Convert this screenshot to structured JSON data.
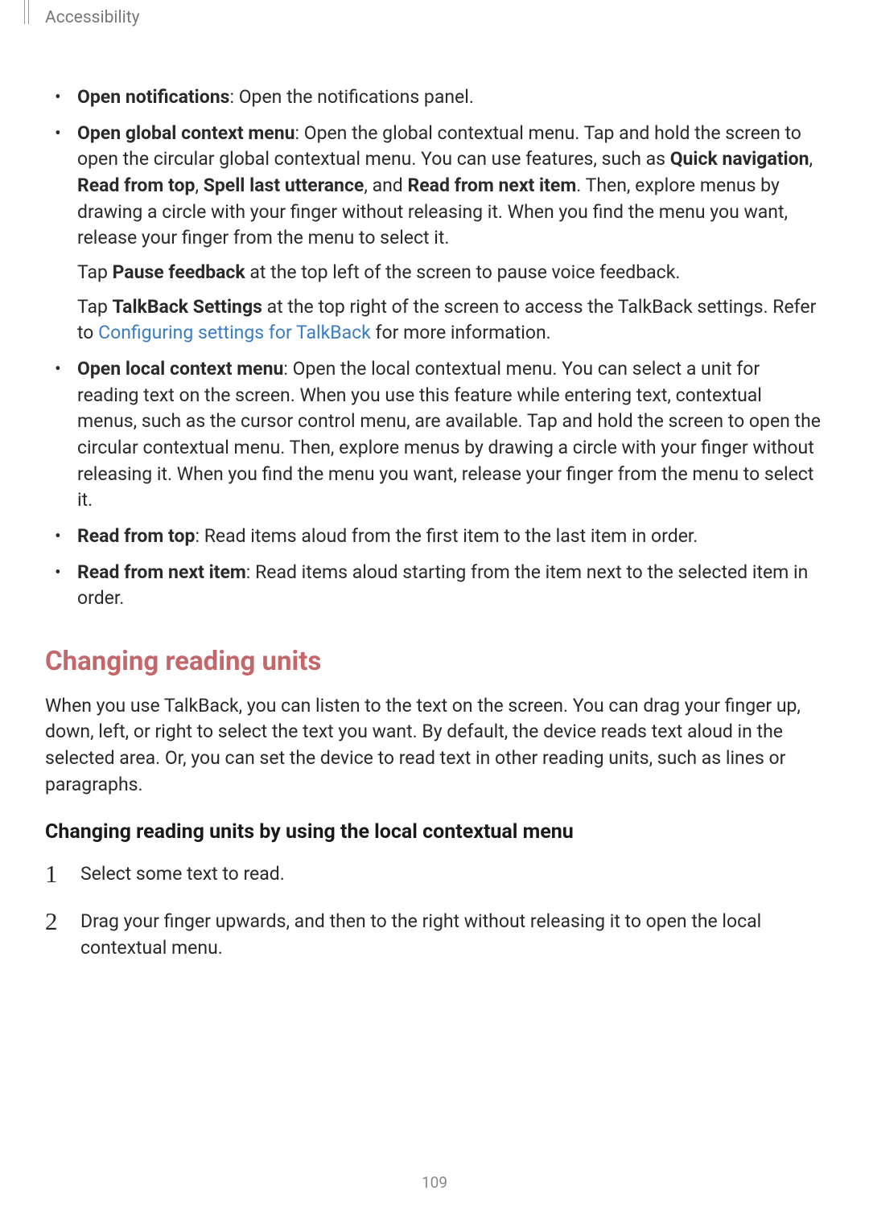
{
  "header": {
    "section": "Accessibility"
  },
  "bullets": {
    "item1": {
      "bold": "Open notifications",
      "rest": ": Open the notifications panel."
    },
    "item2": {
      "bold": "Open global context menu",
      "rest_part1": ": Open the global contextual menu. Tap and hold the screen to open the circular global contextual menu. You can use features, such as ",
      "b1": "Quick navigation",
      "c1": ", ",
      "b2": "Read from top",
      "c2": ", ",
      "b3": "Spell last utterance",
      "c3": ", and ",
      "b4": "Read from next item",
      "rest_part2": ". Then, explore menus by drawing a circle with your finger without releasing it. When you find the menu you want, release your finger from the menu to select it.",
      "sub1_a": "Tap ",
      "sub1_b": "Pause feedback",
      "sub1_c": " at the top left of the screen to pause voice feedback.",
      "sub2_a": "Tap ",
      "sub2_b": "TalkBack Settings",
      "sub2_c": " at the top right of the screen to access the TalkBack settings. Refer to ",
      "sub2_link": "Configuring settings for TalkBack",
      "sub2_d": " for more information."
    },
    "item3": {
      "bold": "Open local context menu",
      "rest": ": Open the local contextual menu. You can select a unit for reading text on the screen. When you use this feature while entering text, contextual menus, such as the cursor control menu, are available. Tap and hold the screen to open the circular contextual menu. Then, explore menus by drawing a circle with your finger without releasing it. When you find the menu you want, release your finger from the menu to select it."
    },
    "item4": {
      "bold": "Read from top",
      "rest": ": Read items aloud from the first item to the last item in order."
    },
    "item5": {
      "bold": "Read from next item",
      "rest": ": Read items aloud starting from the item next to the selected item in order."
    }
  },
  "section": {
    "heading": "Changing reading units",
    "para": "When you use TalkBack, you can listen to the text on the screen. You can drag your finger up, down, left, or right to select the text you want. By default, the device reads text aloud in the selected area. Or, you can set the device to read text in other reading units, such as lines or paragraphs.",
    "subheading": "Changing reading units by using the local contextual menu"
  },
  "steps": {
    "s1_num": "1",
    "s1": "Select some text to read.",
    "s2_num": "2",
    "s2": "Drag your finger upwards, and then to the right without releasing it to open the local contextual menu."
  },
  "page_number": "109"
}
